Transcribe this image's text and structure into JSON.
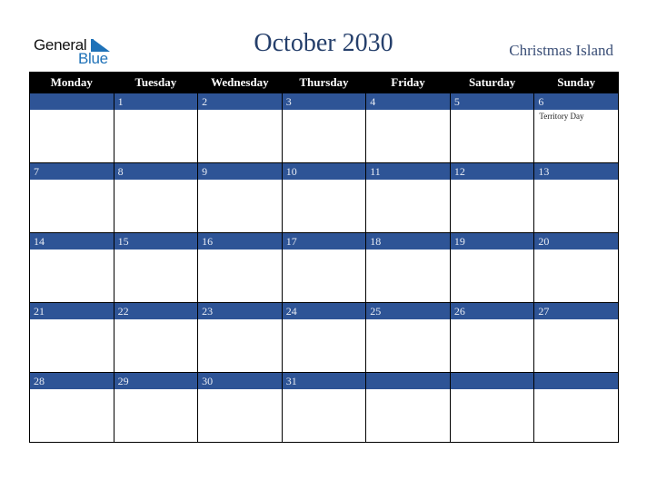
{
  "logo": {
    "line1": "General",
    "line2": "Blue",
    "icon": "triangle-flag-icon"
  },
  "header": {
    "title": "October 2030",
    "region": "Christmas Island"
  },
  "weekdays": [
    "Monday",
    "Tuesday",
    "Wednesday",
    "Thursday",
    "Friday",
    "Saturday",
    "Sunday"
  ],
  "colors": {
    "dayBar": "#2e5496",
    "header": "#000000",
    "title": "#253f6b",
    "logoBlue": "#1f72b8"
  },
  "weeks": [
    [
      {
        "day": ""
      },
      {
        "day": "1"
      },
      {
        "day": "2"
      },
      {
        "day": "3"
      },
      {
        "day": "4"
      },
      {
        "day": "5"
      },
      {
        "day": "6",
        "events": [
          "Territory Day"
        ]
      }
    ],
    [
      {
        "day": "7"
      },
      {
        "day": "8"
      },
      {
        "day": "9"
      },
      {
        "day": "10"
      },
      {
        "day": "11"
      },
      {
        "day": "12"
      },
      {
        "day": "13"
      }
    ],
    [
      {
        "day": "14"
      },
      {
        "day": "15"
      },
      {
        "day": "16"
      },
      {
        "day": "17"
      },
      {
        "day": "18"
      },
      {
        "day": "19"
      },
      {
        "day": "20"
      }
    ],
    [
      {
        "day": "21"
      },
      {
        "day": "22"
      },
      {
        "day": "23"
      },
      {
        "day": "24"
      },
      {
        "day": "25"
      },
      {
        "day": "26"
      },
      {
        "day": "27"
      }
    ],
    [
      {
        "day": "28"
      },
      {
        "day": "29"
      },
      {
        "day": "30"
      },
      {
        "day": "31"
      },
      {
        "day": ""
      },
      {
        "day": ""
      },
      {
        "day": ""
      }
    ]
  ]
}
